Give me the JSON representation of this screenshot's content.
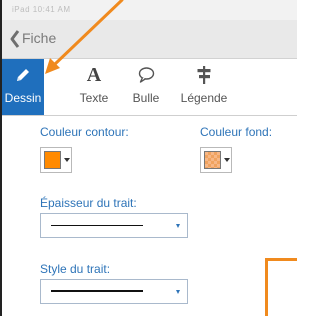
{
  "status_bar": {
    "text": "iPad  10:41 AM"
  },
  "nav": {
    "back_label": "Fiche"
  },
  "tools": [
    {
      "label": "Dessin",
      "icon": "pencil-icon",
      "active": true
    },
    {
      "label": "Texte",
      "icon": "letter-a-icon",
      "active": false
    },
    {
      "label": "Bulle",
      "icon": "speech-bubble-icon",
      "active": false
    },
    {
      "label": "Légende",
      "icon": "signpost-icon",
      "active": false
    }
  ],
  "panel": {
    "stroke_color_label": "Couleur contour:",
    "stroke_color": "#ff8a00",
    "fill_color_label": "Couleur fond:",
    "fill_color": "#f7b786",
    "thickness_label": "Épaisseur du trait:",
    "style_label": "Style du trait:"
  },
  "annotation_color": "#f08a1e",
  "accent_color": "#1f6fbd"
}
